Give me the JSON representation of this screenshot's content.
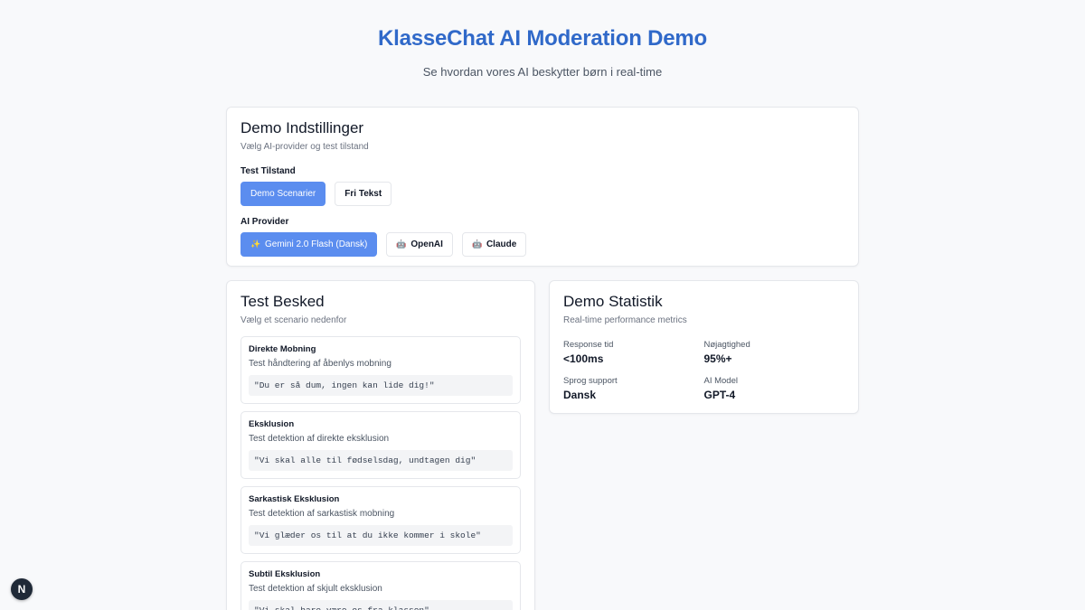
{
  "header": {
    "title": "KlasseChat AI Moderation Demo",
    "subtitle": "Se hvordan vores AI beskytter børn i real-time"
  },
  "settings": {
    "title": "Demo Indstillinger",
    "subtitle": "Vælg AI-provider og test tilstand",
    "mode_label": "Test Tilstand",
    "modes": [
      {
        "label": "Demo Scenarier",
        "active": true
      },
      {
        "label": "Fri Tekst",
        "active": false
      }
    ],
    "provider_label": "AI Provider",
    "providers": [
      {
        "label": "Gemini 2.0 Flash (Dansk)",
        "icon": "sparkle-icon",
        "glyph": "✨",
        "active": true
      },
      {
        "label": "OpenAI",
        "icon": "robot-icon",
        "glyph": "🤖",
        "active": false
      },
      {
        "label": "Claude",
        "icon": "robot-icon",
        "glyph": "🤖",
        "active": false
      }
    ]
  },
  "test": {
    "title": "Test Besked",
    "subtitle": "Vælg et scenario nedenfor",
    "scenarios": [
      {
        "title": "Direkte Mobning",
        "desc": "Test håndtering af åbenlys mobning",
        "quote": "\"Du er så dum, ingen kan lide dig!\""
      },
      {
        "title": "Eksklusion",
        "desc": "Test detektion af direkte eksklusion",
        "quote": "\"Vi skal alle til fødselsdag, undtagen dig\""
      },
      {
        "title": "Sarkastisk Eksklusion",
        "desc": "Test detektion af sarkastisk mobning",
        "quote": "\"Vi glæder os til at du ikke kommer i skole\""
      },
      {
        "title": "Subtil Eksklusion",
        "desc": "Test detektion af skjult eksklusion",
        "quote": "\"Vi skal bare være os fra klassen\""
      }
    ]
  },
  "stats": {
    "title": "Demo Statistik",
    "subtitle": "Real-time performance metrics",
    "items": [
      {
        "label": "Response tid",
        "value": "<100ms"
      },
      {
        "label": "Nøjagtighed",
        "value": "95%+"
      },
      {
        "label": "Sprog support",
        "value": "Dansk"
      },
      {
        "label": "AI Model",
        "value": "GPT-4"
      }
    ]
  },
  "badge": {
    "letter": "N"
  },
  "colors": {
    "accent": "#3069c9",
    "active_button": "#5b8def",
    "badge_bg": "#1f2937"
  }
}
